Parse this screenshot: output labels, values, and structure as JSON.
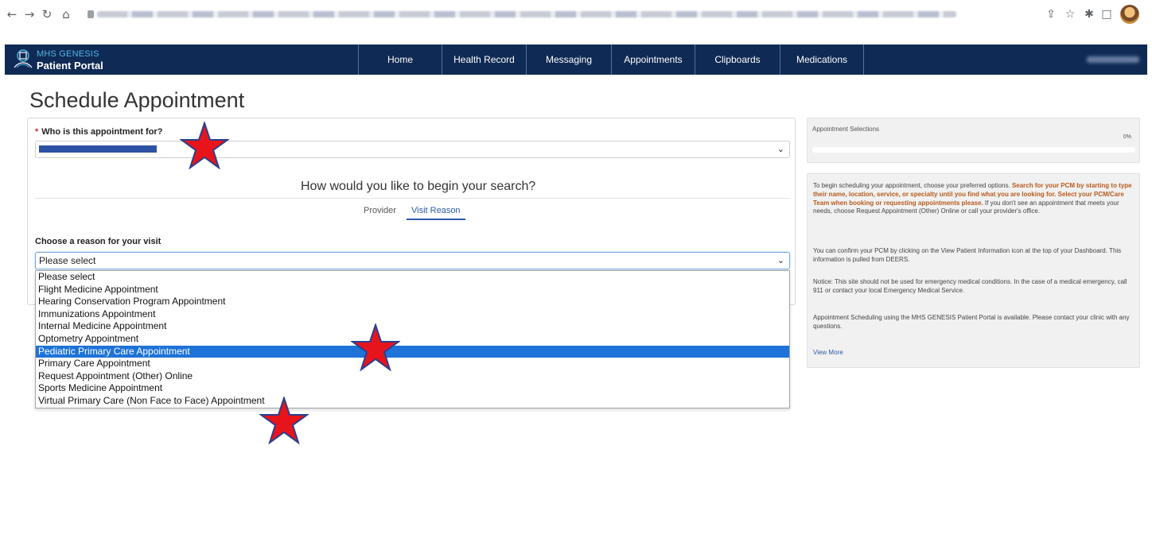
{
  "browser": {
    "back_icon": "back-arrow-icon",
    "forward_icon": "forward-arrow-icon",
    "reload_icon": "reload-icon",
    "home_icon": "home-icon",
    "share_icon": "share-icon",
    "bookmark_icon": "star-outline-icon",
    "extensions_icon": "puzzle-icon",
    "sidepanel_icon": "side-panel-icon"
  },
  "header": {
    "logo_title": "MHS GENESIS",
    "logo_subtitle": "Patient Portal",
    "nav": [
      "Home",
      "Health Record",
      "Messaging",
      "Appointments",
      "Clipboards",
      "Medications"
    ],
    "brand_color": "#0f2a54",
    "accent_color": "#4fb7e8"
  },
  "page": {
    "title": "Schedule Appointment"
  },
  "form": {
    "who_required_mark": "*",
    "who_label": "Who is this appointment for?",
    "search_heading": "How would you like to begin your search?",
    "tabs": {
      "provider": "Provider",
      "visit_reason": "Visit Reason",
      "active": "Visit Reason"
    },
    "reason_label": "Choose a reason for your visit",
    "reason_value": "Please select",
    "reason_options": [
      "Please select",
      "Flight Medicine Appointment",
      "Hearing Conservation Program Appointment",
      "Immunizations Appointment",
      "Internal Medicine Appointment",
      "Optometry Appointment",
      "Pediatric Primary Care Appointment",
      "Primary Care Appointment",
      "Request Appointment (Other) Online",
      "Sports Medicine Appointment",
      "Virtual Primary Care (Non Face to Face) Appointment"
    ],
    "highlighted_option": "Pediatric Primary Care Appointment",
    "highlight_color": "#1e73d8"
  },
  "sidebar": {
    "progress_label": "Appointment Selections",
    "progress_percent": "0%",
    "progress_value": 0,
    "para1_a": "To begin scheduling your appointment, choose your preferred options. ",
    "para1_b": "Search for your PCM by starting to type their name, location, service, or specialty until you find what you are looking for. Select your PCM/Care Team when booking or requesting appointments please.",
    "para1_c": " If you don't see an appointment that meets your needs, choose Request Appointment (Other) Online or call your provider's office.",
    "para2": "You can confirm your PCM by clicking on the View Patient Information icon at the top of your Dashboard. This information is pulled from DEERS.",
    "para3": "Notice: This site should not be used for emergency medical conditions. In the case of a medical emergency, call 911 or contact your local Emergency Medical Service.",
    "para4": "Appointment Scheduling using the MHS GENESIS Patient Portal is available. Please contact your clinic with any questions.",
    "view_more": "View More"
  },
  "annotations": {
    "star_color": "#e8141b",
    "star_outline": "#2a3f8f"
  }
}
